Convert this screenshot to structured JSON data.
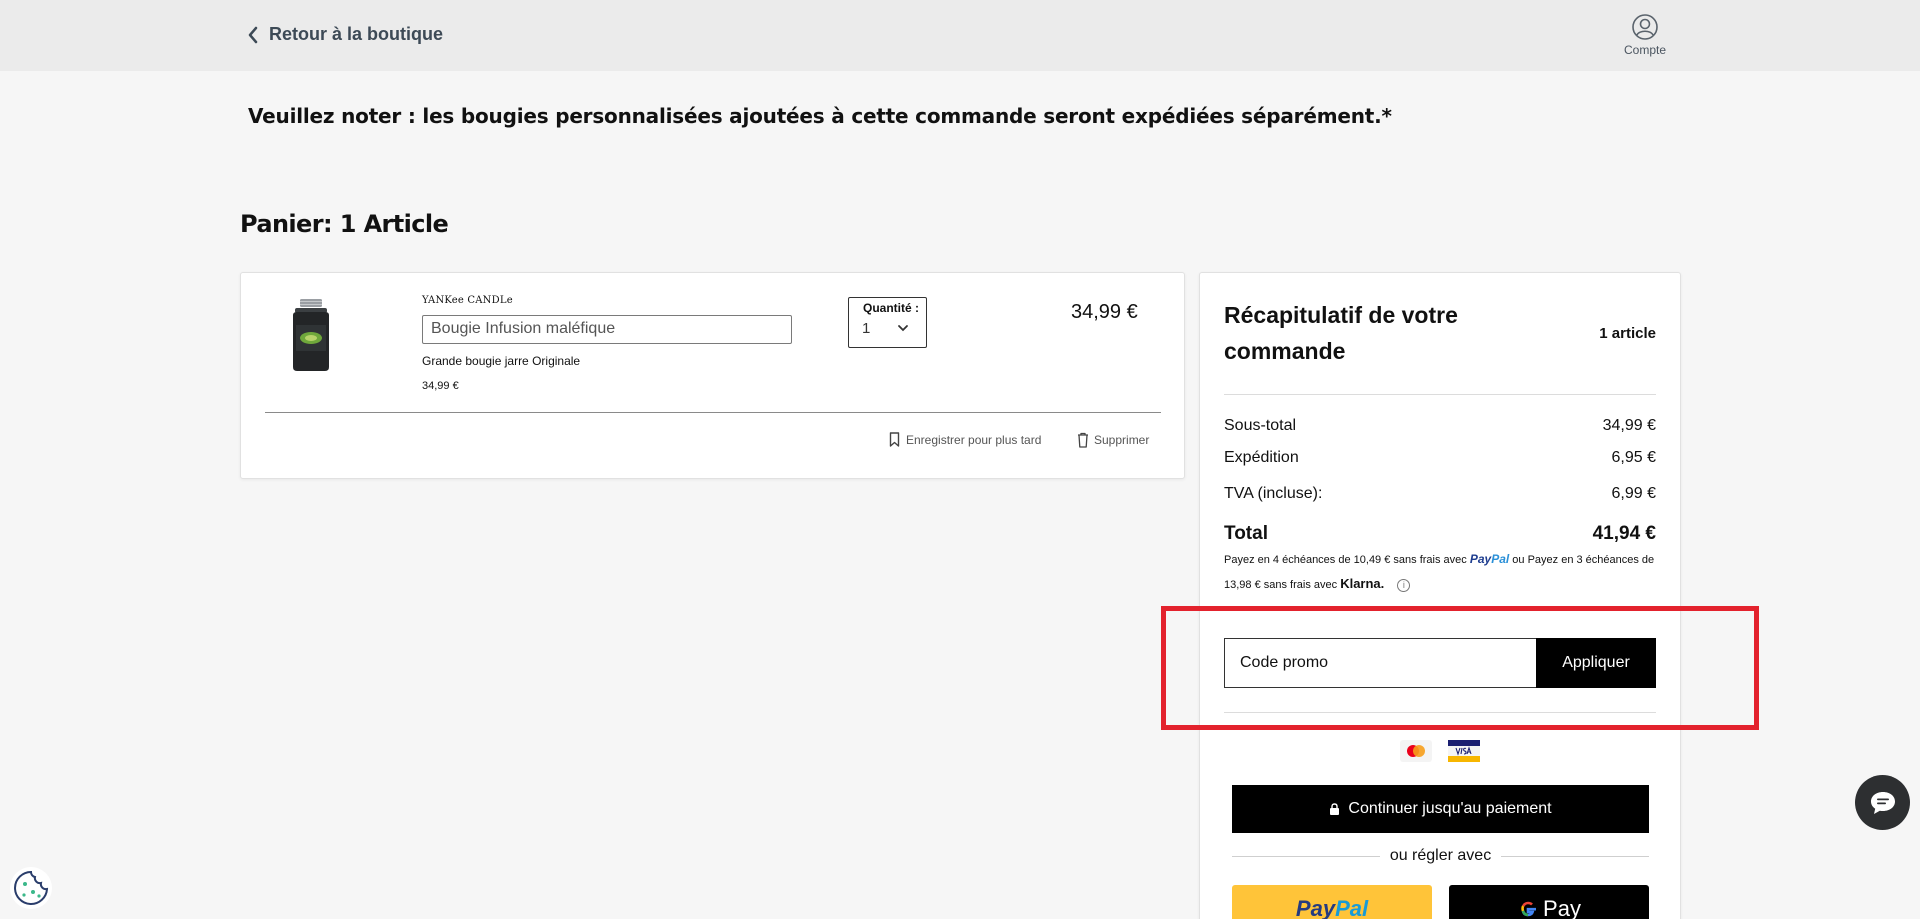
{
  "header": {
    "back_label": "Retour à la boutique",
    "account_label": "Compte"
  },
  "notice": "Veuillez noter : les bougies personnalisées ajoutées à cette commande seront expédiées séparément.*",
  "cart": {
    "title": "Panier: 1 Article",
    "item": {
      "brand": "YANKee CANDLe",
      "name": "Bougie Infusion maléfique",
      "variant": "Grande bougie jarre Originale",
      "unit_price": "34,99 €",
      "quantity_label": "Quantité :",
      "quantity_value": "1",
      "line_price": "34,99 €",
      "save_later": "Enregistrer pour plus tard",
      "remove": "Supprimer"
    }
  },
  "summary": {
    "title": "Récapitulatif de votre commande",
    "count": "1 article",
    "subtotal_label": "Sous-total",
    "subtotal_value": "34,99 €",
    "shipping_label": "Expédition",
    "shipping_value": "6,95 €",
    "vat_label": "TVA (incluse):",
    "vat_value": "6,99 €",
    "total_label": "Total",
    "total_value": "41,94 €",
    "installments_part1": "Payez en 4 échéances de 10,49 € sans frais avec",
    "paypal_pay": "Pay",
    "paypal_pal": "Pal",
    "installments_part2": "ou Payez en 3 échéances de 13,98 € sans frais avec",
    "klarna": "Klarna.",
    "info_glyph": "i",
    "promo_placeholder": "Code promo",
    "promo_button": "Appliquer",
    "checkout_button": "Continuer jusqu'au paiement",
    "alt_pay_label": "ou régler avec",
    "gpay_label": "Pay"
  },
  "colors": {
    "accent": "#000000",
    "highlight": "#e3222d",
    "paypal_yellow": "#ffc439"
  }
}
